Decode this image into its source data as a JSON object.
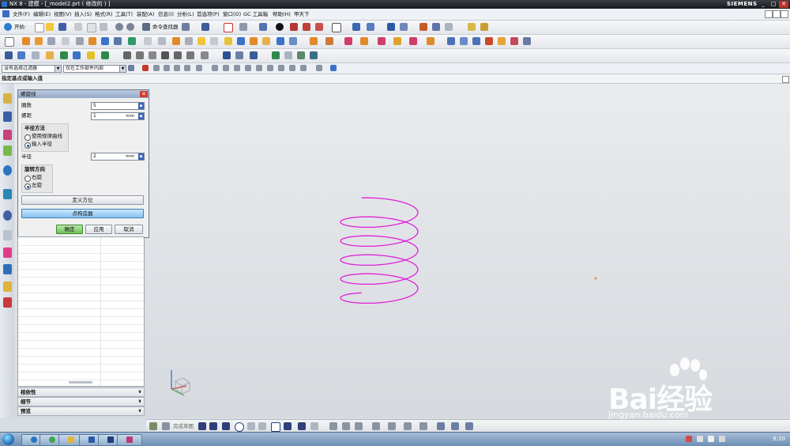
{
  "window": {
    "title": "NX 8 - 建模 - [_model2.prt  ( 修改的 ) ]",
    "brand": "SIEMENS",
    "minimize": "_",
    "maximize": "□",
    "close": "✕"
  },
  "menubar": {
    "items": [
      "文件(F)",
      "编辑(E)",
      "视图(V)",
      "插入(S)",
      "格式(R)",
      "工具(T)",
      "装配(A)",
      "信息(I)",
      "分析(L)",
      "首选项(P)",
      "窗口(O)",
      "GC 工具箱",
      "帮助(H)",
      "甲天下"
    ]
  },
  "toolbar1": {
    "start_label": "开始·",
    "command_finder_label": "命令查找器"
  },
  "selection_bar": {
    "filter_value": "没有选择过滤器",
    "scope_value": "仅在工作部件内部"
  },
  "cue_line": "指定基点或输入值",
  "dialog": {
    "title": "螺旋线",
    "turns_label": "圈数",
    "turns_value": "5",
    "pitch_label": "螺距",
    "pitch_value": "1",
    "pitch_unit": "mm",
    "radius_method_title": "半径方法",
    "radius_method_option_law": "使用规律曲线",
    "radius_method_option_input": "输入半径",
    "radius_label": "半径",
    "radius_value": "2",
    "radius_unit": "mm",
    "rotation_title": "旋转方向",
    "rotation_right": "右旋",
    "rotation_left": "左旋",
    "define_orientation": "定义方位",
    "point_constructor": "点构造器",
    "ok": "确定",
    "apply": "应用",
    "cancel": "取消"
  },
  "nav_sections": [
    "相依性",
    "细节",
    "预览"
  ],
  "bottom_toolbar": {
    "sketch_label": "完成草图"
  },
  "taskbar": {
    "clock": "8:20"
  },
  "watermark": {
    "brand": "Bai经验",
    "url": "jingyan.baidu.com"
  },
  "colors": {
    "helix": "#e020d8",
    "title_gradient_top": "#3a3f46",
    "dialog_title": "#93a9c8",
    "ok_button": "#6fc15a",
    "point_constructor_button": "#87c3ef"
  }
}
